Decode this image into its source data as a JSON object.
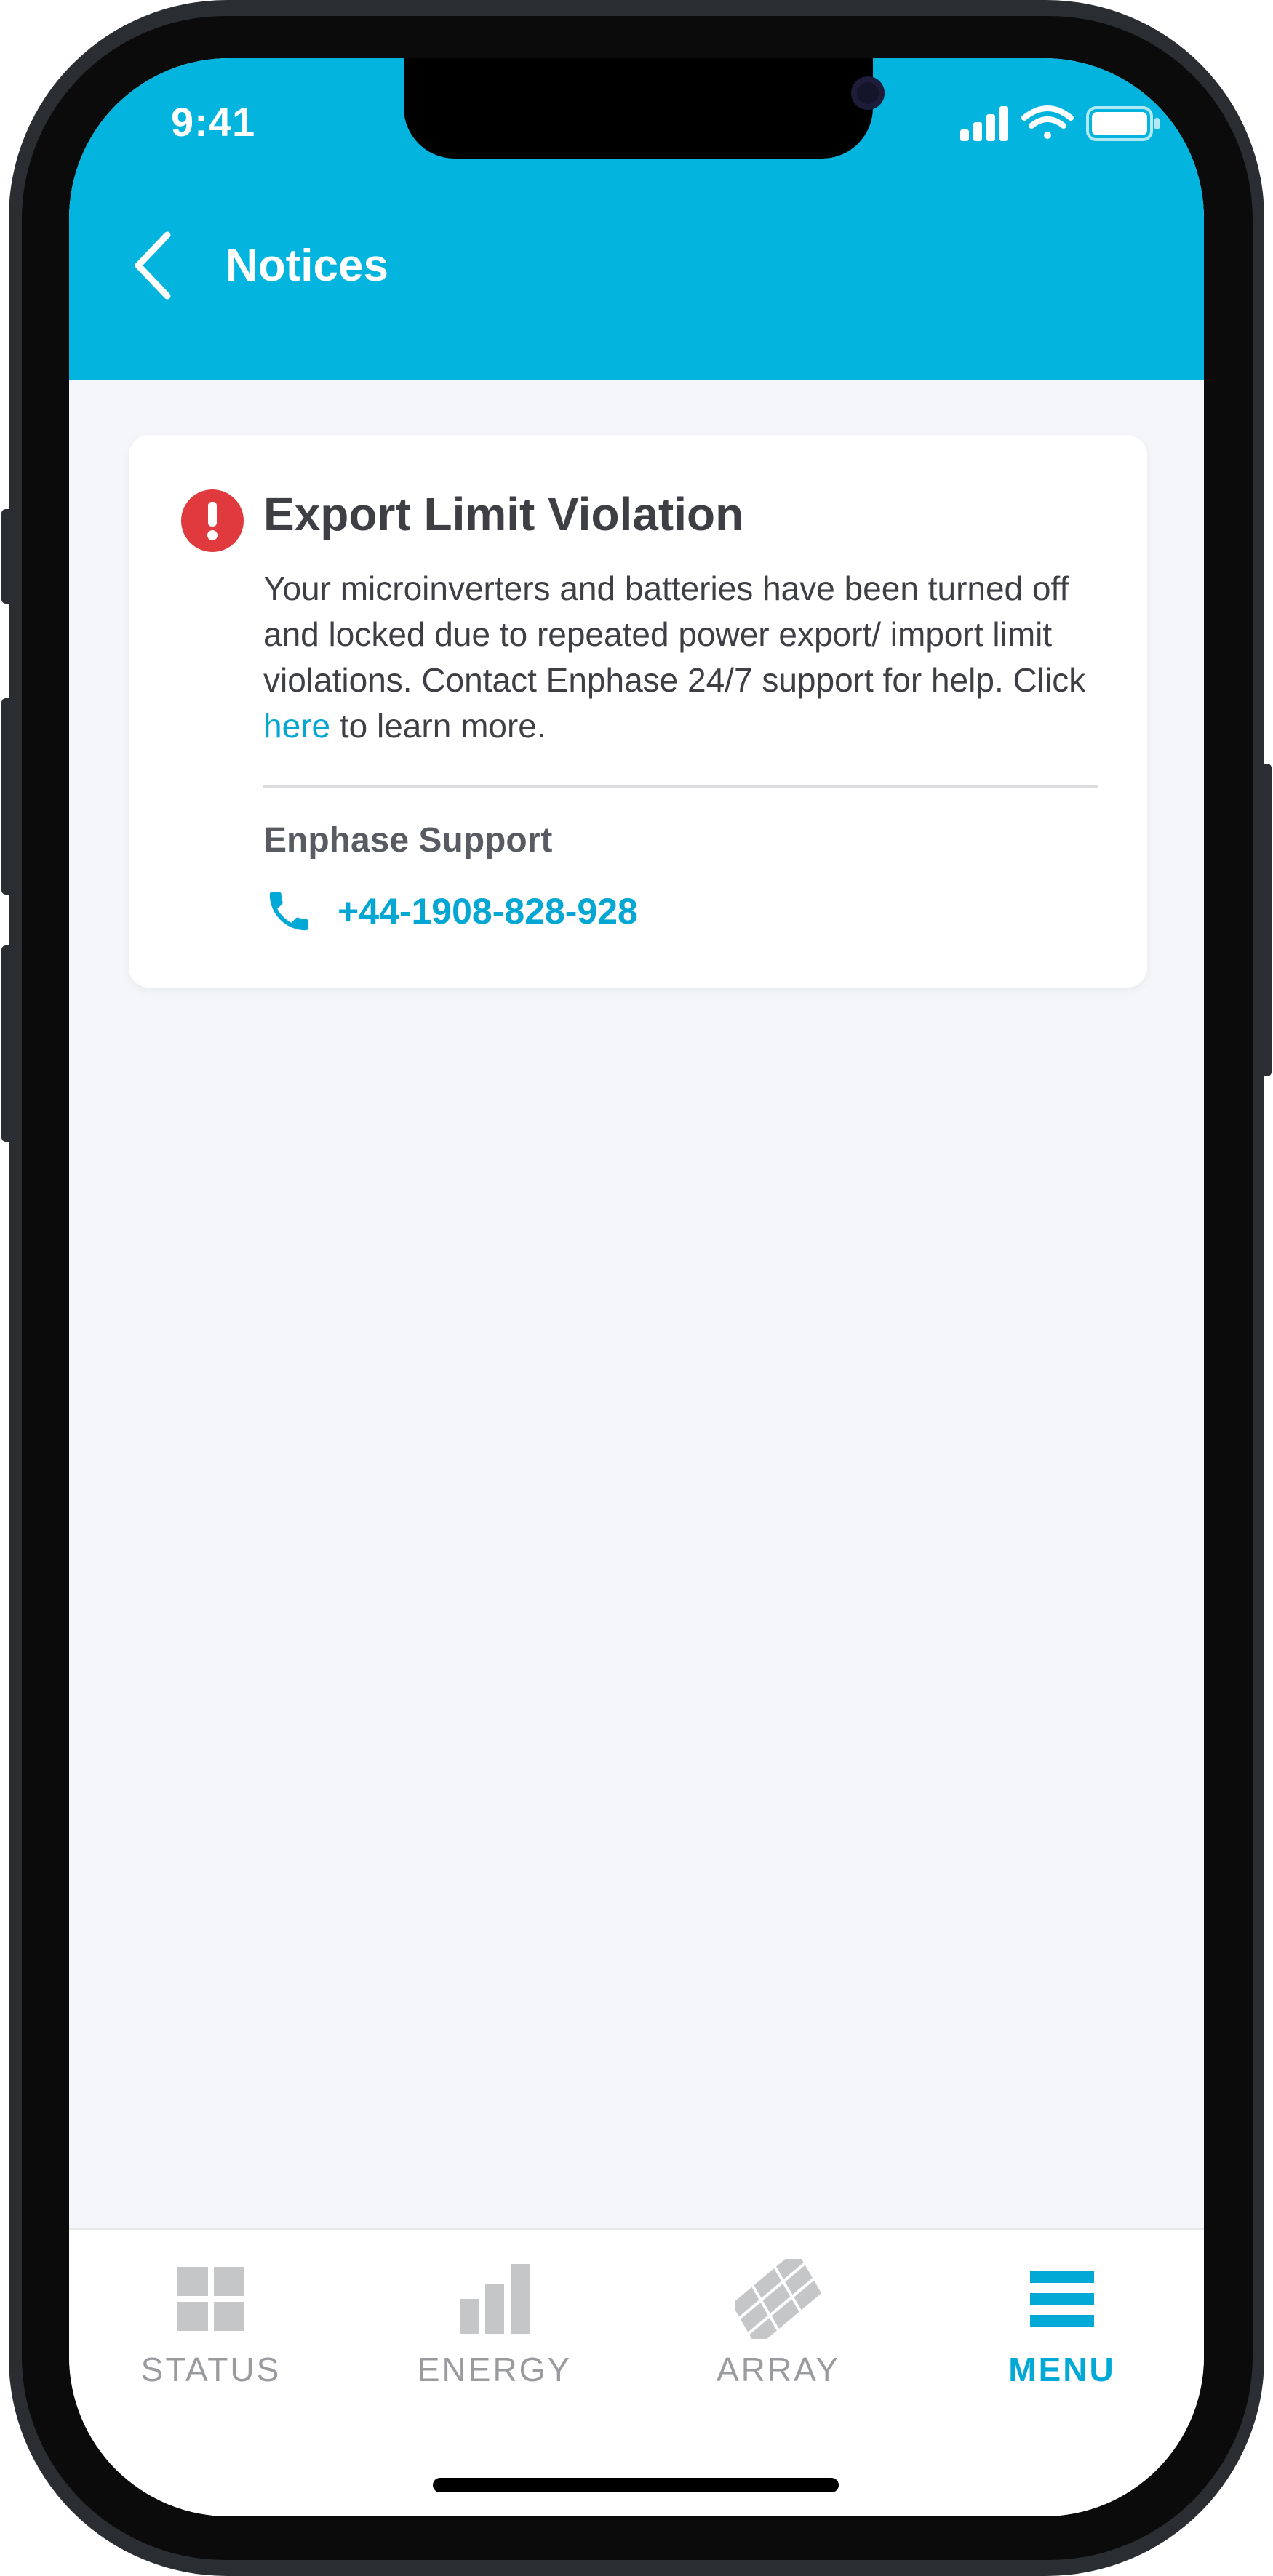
{
  "status_bar": {
    "time": "9:41"
  },
  "header": {
    "title": "Notices"
  },
  "notice": {
    "title": "Export Limit Violation",
    "body_before_link": "Your microinverters and batteries have been turned off and locked due to repeated power export/ import limit violations. Contact Enphase 24/7 support for help. Click ",
    "link_text": "here",
    "body_after_link": " to learn more.",
    "support_label": "Enphase Support",
    "support_phone": "+44-1908-828-928"
  },
  "tabs": [
    {
      "label": "STATUS",
      "icon": "grid-icon",
      "active": false
    },
    {
      "label": "ENERGY",
      "icon": "bar-chart-icon",
      "active": false
    },
    {
      "label": "ARRAY",
      "icon": "solar-array-icon",
      "active": false
    },
    {
      "label": "MENU",
      "icon": "menu-icon",
      "active": true
    }
  ],
  "colors": {
    "brand": "#02b4de",
    "link": "#04a7d4",
    "alert": "#e03a3e",
    "inactive_tab": "#9a9b9f",
    "background": "#f4f6f9"
  }
}
